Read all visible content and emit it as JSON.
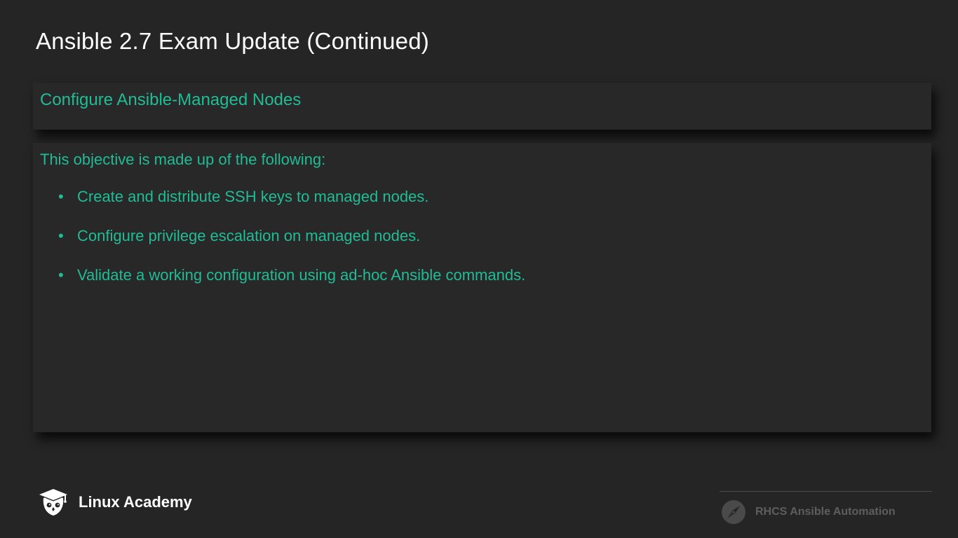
{
  "slide": {
    "title": "Ansible 2.7 Exam Update (Continued)"
  },
  "objective": {
    "title": "Configure Ansible-Managed Nodes",
    "intro": "This objective is made up of the following:",
    "items": [
      "Create and distribute SSH keys to managed nodes.",
      "Configure privilege escalation on managed nodes.",
      "Validate a working configuration using ad-hoc Ansible commands."
    ],
    "bullet": "•"
  },
  "footer": {
    "brand_name": "Linux Academy",
    "brand_icon": "owl-graduation-cap-icon",
    "course_name": "RHCS Ansible Automation",
    "course_icon": "compass-icon"
  },
  "colors": {
    "background": "#252525",
    "panel": "#282828",
    "accent": "#21bc96",
    "title": "#ffffff",
    "muted": "#5e5e5e"
  }
}
